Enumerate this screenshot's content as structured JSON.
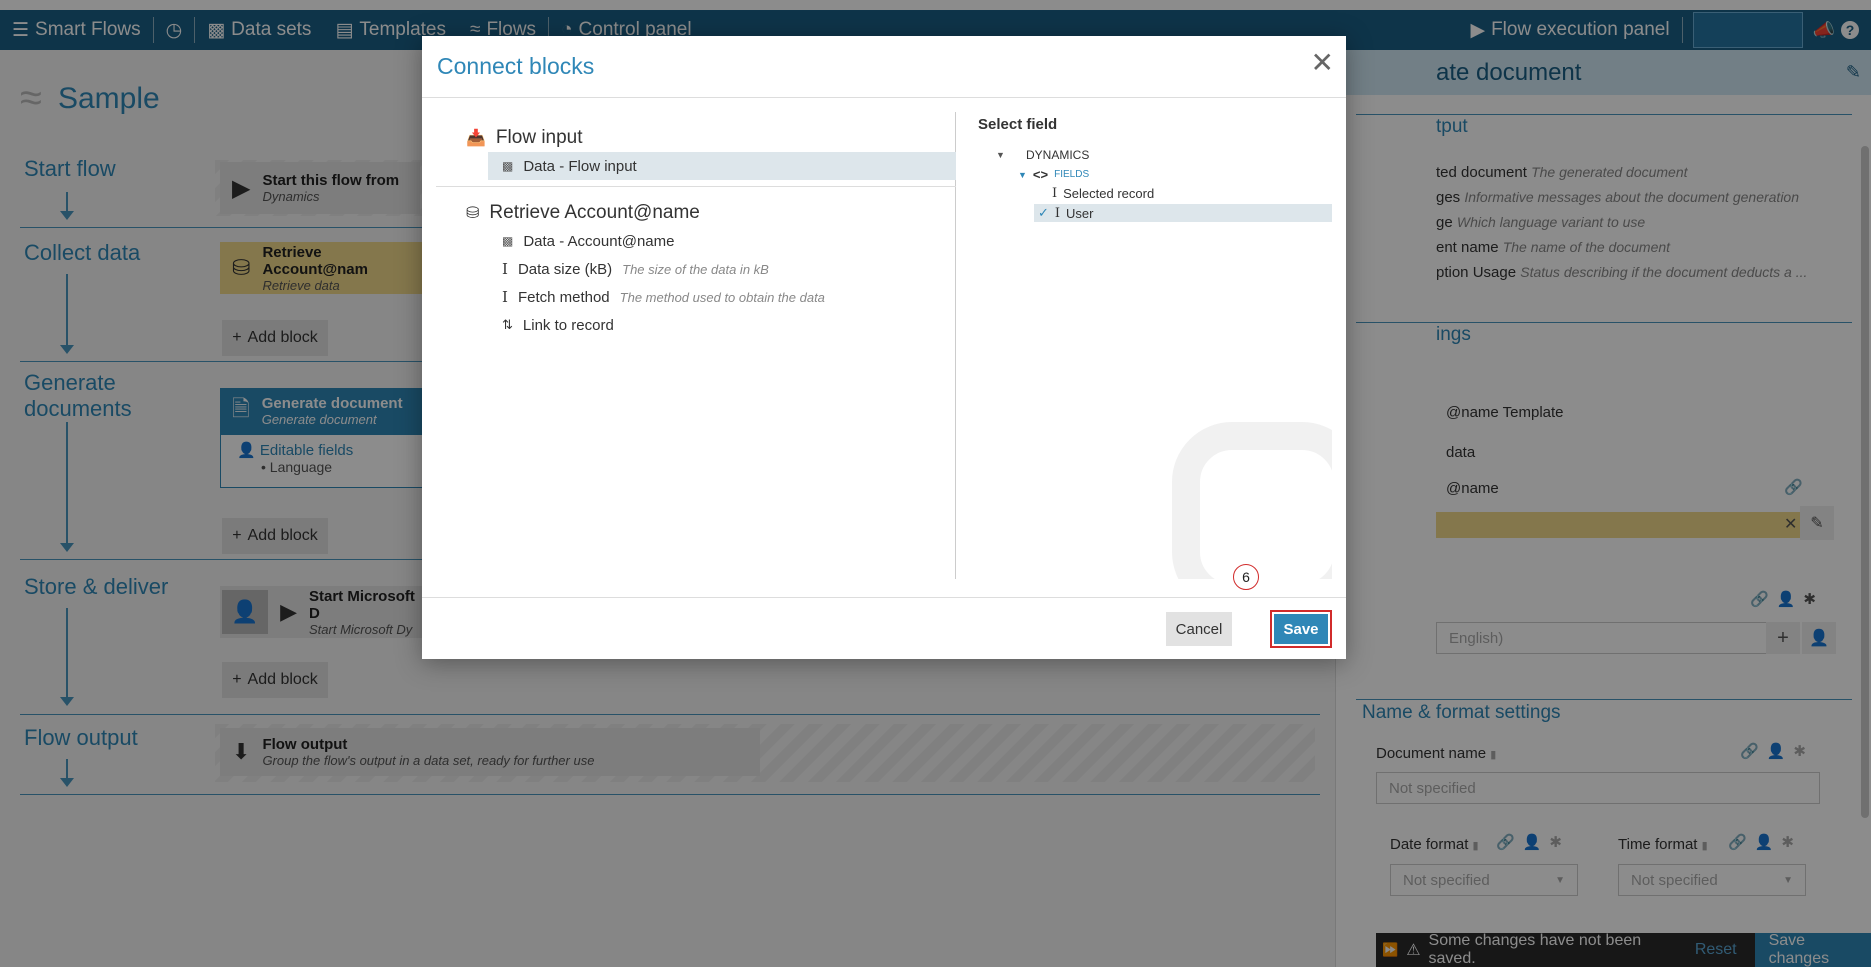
{
  "nav": {
    "brand": "Smart Flows",
    "data_sets": "Data sets",
    "templates": "Templates",
    "flows": "Flows",
    "control_panel": "Control panel",
    "flow_execution": "Flow execution panel"
  },
  "page": {
    "title": "Sample"
  },
  "stages": {
    "start": "Start flow",
    "collect": "Collect data",
    "generate": "Generate documents",
    "store": "Store & deliver",
    "output": "Flow output"
  },
  "blocks": {
    "start_title": "Start this flow from",
    "start_sub": "Dynamics",
    "retrieve_title": "Retrieve Account@nam",
    "retrieve_sub": "Retrieve data",
    "generate_title": "Generate document",
    "generate_sub": "Generate document",
    "editable_fields": "Editable fields",
    "language": "Language",
    "store_title": "Start Microsoft D",
    "store_sub": "Start Microsoft Dy",
    "output_title": "Flow output",
    "output_sub": "Group the flow's output in a data set, ready for further use",
    "add_block": "Add block"
  },
  "rpanel": {
    "header": "ate document",
    "output_title": "tput",
    "outputs": [
      {
        "name": "ted document",
        "desc": "The generated document"
      },
      {
        "name": "ges",
        "desc": "Informative messages about the document generation"
      },
      {
        "name": "ge",
        "desc": "Which language variant to use"
      },
      {
        "name": "ent name",
        "desc": "The name of the document"
      },
      {
        "name": "ption Usage",
        "desc": "Status describing if the document deducts a ..."
      }
    ],
    "settings_title": "ings",
    "template_label": "@name Template",
    "data_label": "data",
    "account_label": "@name",
    "language_placeholder": "English)",
    "name_format_title": "Name & format settings",
    "document_name": "Document name",
    "not_specified": "Not specified",
    "date_format": "Date format",
    "time_format": "Time format"
  },
  "status": {
    "message": "Some changes have not been saved.",
    "reset": "Reset",
    "save_changes": "Save changes"
  },
  "modal": {
    "title": "Connect blocks",
    "flow_input": "Flow input",
    "data_flow_input": "Data - Flow input",
    "retrieve": "Retrieve Account@name",
    "data_account": "Data - Account@name",
    "data_size": "Data size (kB)",
    "data_size_desc": "The size of the data in kB",
    "fetch_method": "Fetch method",
    "fetch_method_desc": "The method used to obtain the data",
    "link_record": "Link to record",
    "select_field": "Select field",
    "dynamics": "DYNAMICS",
    "fields": "FIELDS",
    "selected_record": "Selected record",
    "user": "User",
    "cancel": "Cancel",
    "save": "Save",
    "step_marker": "6"
  }
}
